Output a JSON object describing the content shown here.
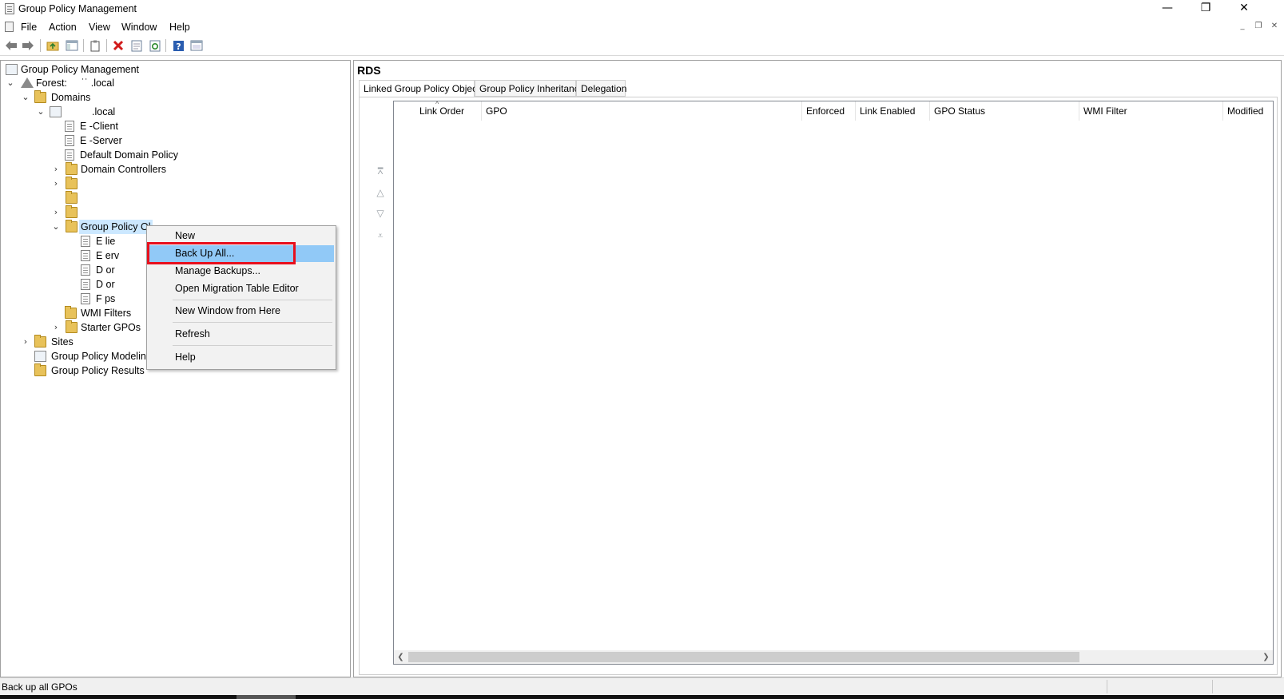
{
  "window": {
    "title": "Group Policy Management",
    "minimize": "—",
    "restore": "❐",
    "close": "✕"
  },
  "menu": [
    "File",
    "Action",
    "View",
    "Window",
    "Help"
  ],
  "mdi_controls": {
    "minimize": "_",
    "restore": "❐",
    "close": "✕"
  },
  "toolbar": {
    "icons": [
      "back-arrow-icon",
      "forward-arrow-icon",
      "up-folder-icon",
      "show-hide-tree-icon",
      "clipboard-icon",
      "delete-icon",
      "properties-icon",
      "refresh-icon",
      "help-icon",
      "console-icon"
    ]
  },
  "tree": {
    "root": "Group Policy Management",
    "forest_prefix": "Forest:",
    "forest_name": "˙˙ .local",
    "domains": "Domains",
    "domain_name": ".local",
    "items": [
      {
        "label": "E          -Client"
      },
      {
        "label": "E          -Server"
      },
      {
        "label": "Default Domain Policy"
      },
      {
        "label": "Domain Controllers"
      }
    ],
    "gpo_folder": "Group Policy Ol",
    "gpo_items": [
      "E              lie",
      "E              erv",
      "D              or",
      "D              or",
      "F              ps"
    ],
    "wmi_filters": "WMI Filters",
    "starter_gpos": "Starter GPOs",
    "sites": "Sites",
    "modeling": "Group Policy Modeling",
    "results": "Group Policy Results"
  },
  "context_menu": {
    "items": [
      {
        "label": "New"
      },
      {
        "label": "Back Up All..."
      },
      {
        "label": "Manage Backups..."
      },
      {
        "label": "Open Migration Table Editor"
      },
      {
        "label": "New Window from Here"
      },
      {
        "label": "Refresh"
      },
      {
        "label": "Help"
      }
    ],
    "highlighted": "Back Up All...",
    "highlight_color": "#91c9f7",
    "annotation_color": "#e8101d"
  },
  "right_pane": {
    "title": "RDS",
    "tabs": [
      "Linked Group Policy Objects",
      "Group Policy Inheritance",
      "Delegation"
    ],
    "active_tab": "Linked Group Policy Objects",
    "columns": [
      "Link Order",
      "GPO",
      "Enforced",
      "Link Enabled",
      "GPO Status",
      "WMI Filter",
      "Modified"
    ],
    "order_buttons": [
      "move-to-top-icon",
      "move-up-icon",
      "move-down-icon",
      "move-to-bottom-icon"
    ]
  },
  "status": {
    "text": "Back up all GPOs"
  }
}
